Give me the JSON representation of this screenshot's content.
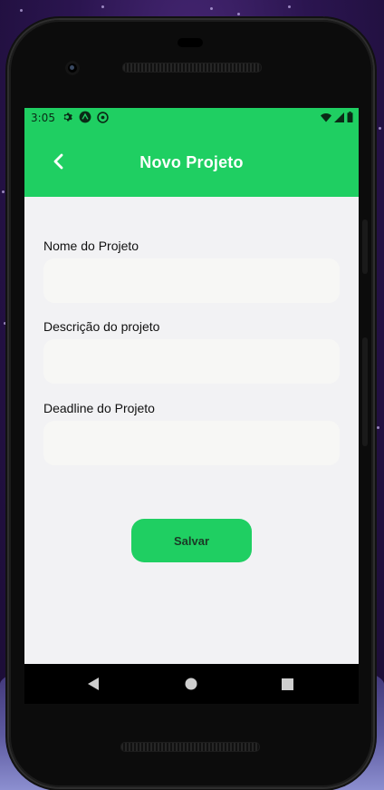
{
  "status_bar": {
    "time": "3:05",
    "left_icons": [
      "gear-icon",
      "react-icon",
      "sync-icon"
    ],
    "right_icons": [
      "wifi-icon",
      "signal-icon",
      "battery-icon"
    ]
  },
  "app_bar": {
    "title": "Novo Projeto",
    "back_icon": "chevron-left-icon"
  },
  "form": {
    "fields": [
      {
        "label": "Nome do Projeto",
        "value": ""
      },
      {
        "label": "Descrição do projeto",
        "value": ""
      },
      {
        "label": "Deadline do Projeto",
        "value": ""
      }
    ],
    "save_label": "Salvar"
  },
  "nav_bar": {
    "buttons": [
      "back-triangle-icon",
      "home-circle-icon",
      "recents-square-icon"
    ]
  },
  "colors": {
    "accent": "#1fcf62",
    "screen_background": "#f2f2f4",
    "input_background": "#f7f7f5"
  }
}
